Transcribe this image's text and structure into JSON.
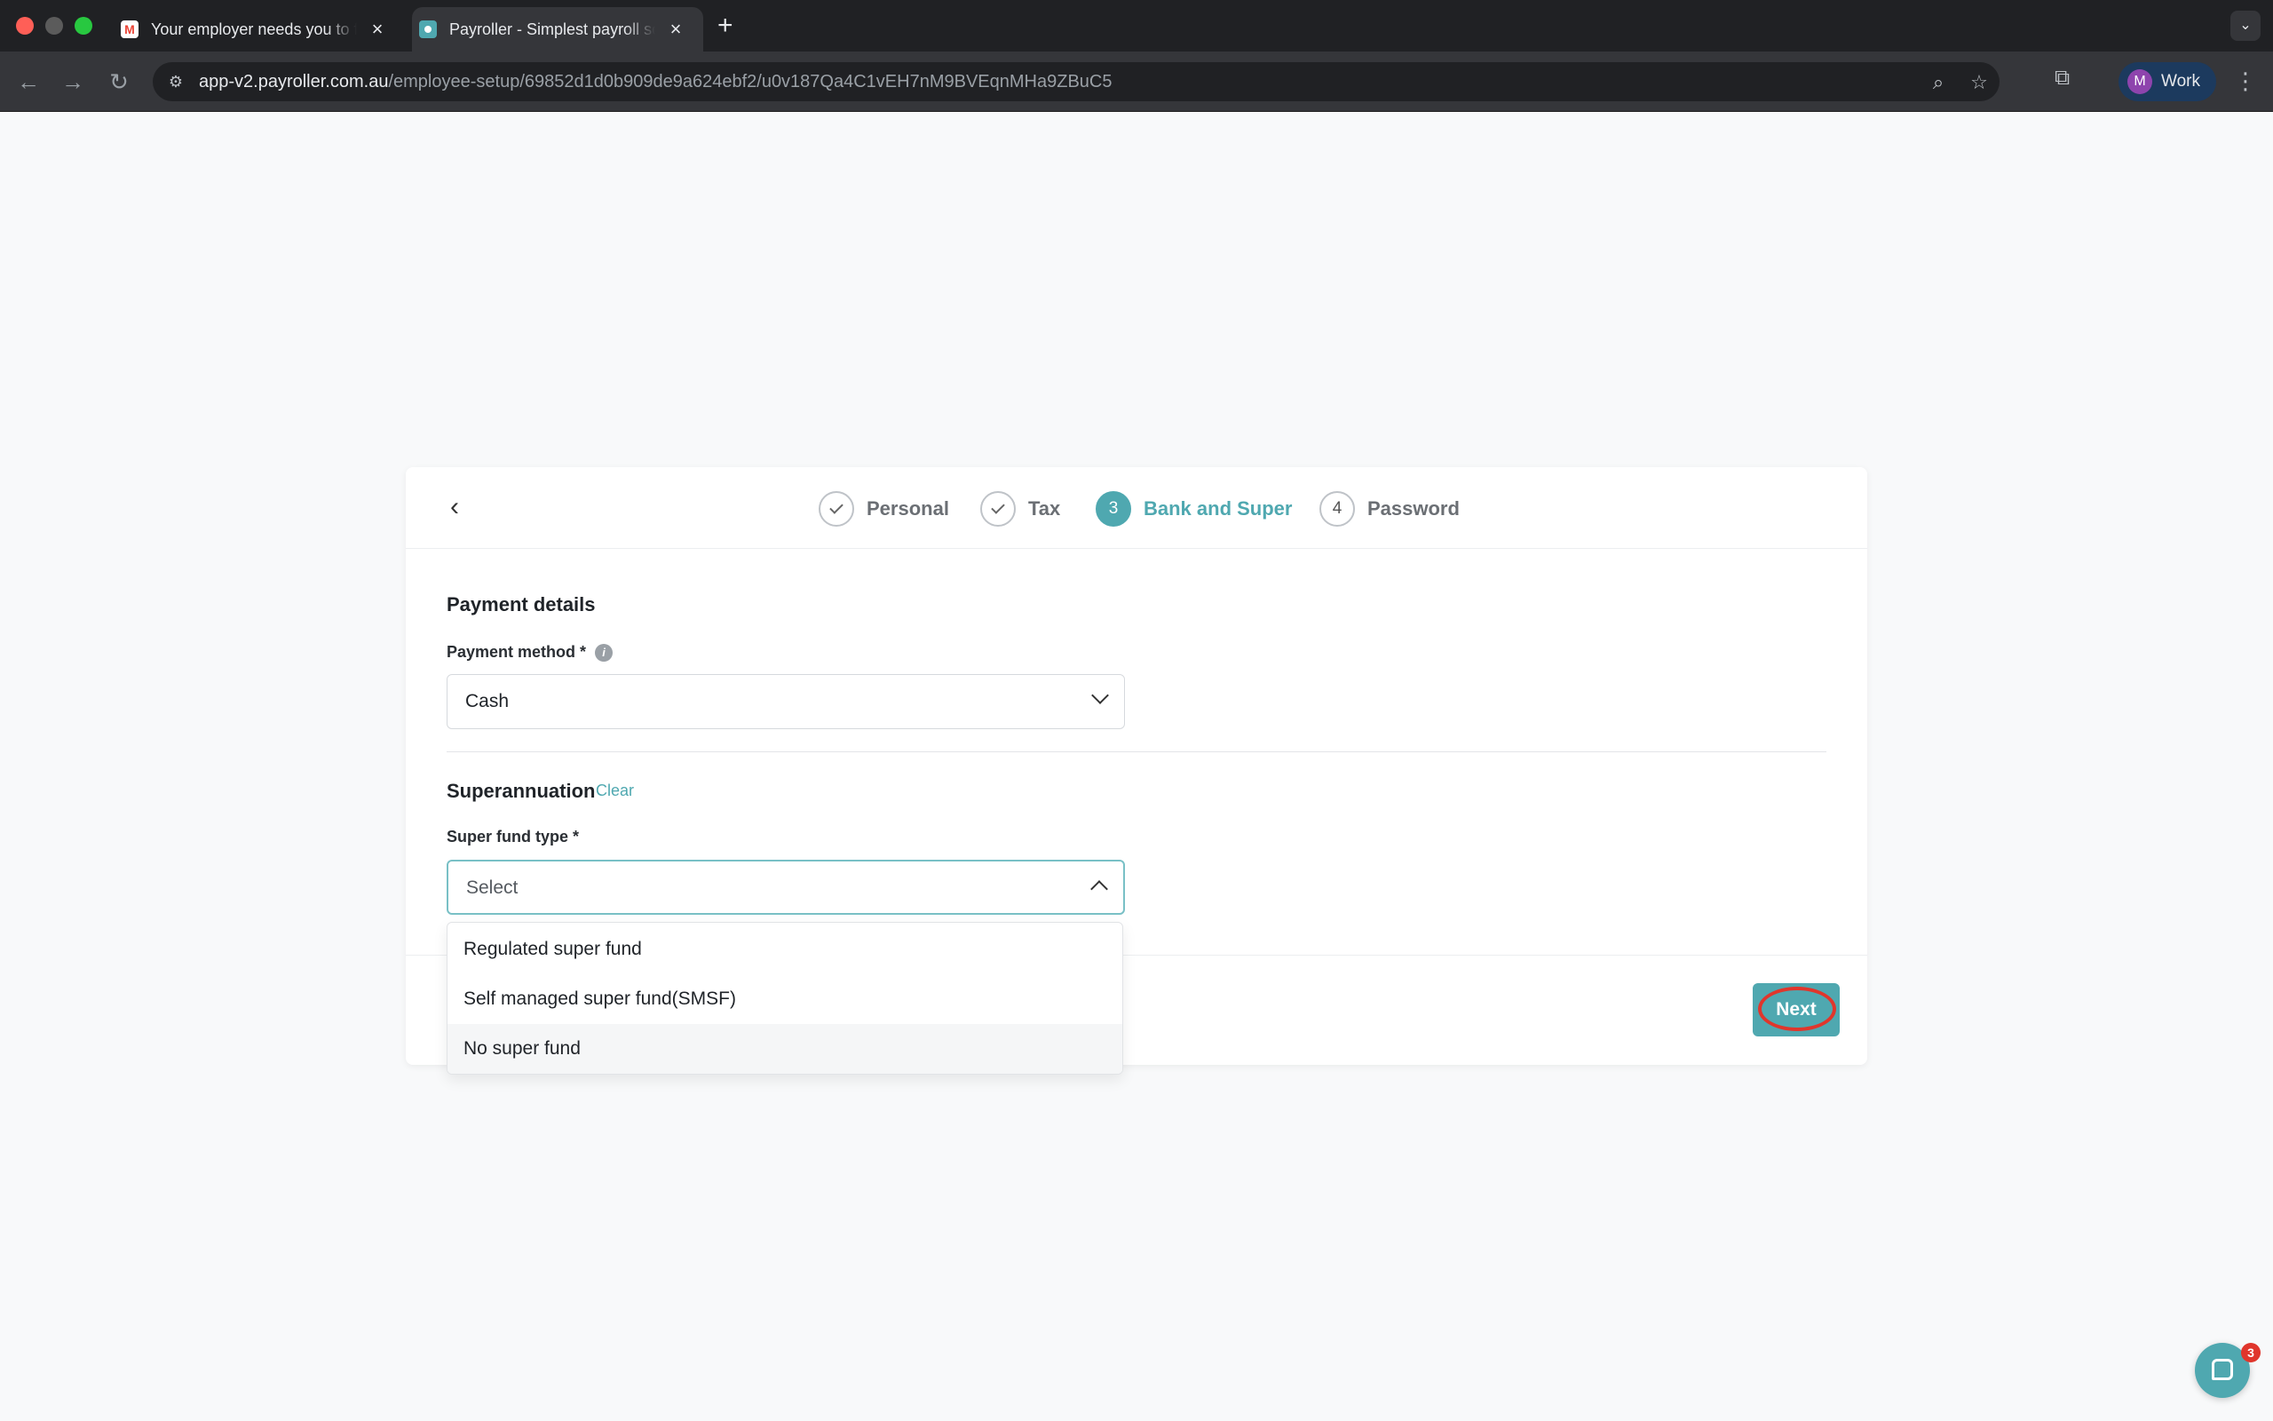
{
  "browser": {
    "tabs": [
      {
        "title": "Your employer needs you to f",
        "favicon": "gmail-icon",
        "active": false
      },
      {
        "title": "Payroller - Simplest payroll so",
        "favicon": "payroller-icon",
        "active": true
      }
    ],
    "url_host": "app-v2.payroller.com.au",
    "url_path": "/employee-setup/69852d1d0b909de9a624ebf2/u0v187Qa4C1vEH7nM9BVEqnMHa9ZBuC5",
    "profile_initial": "M",
    "profile_name": "Work"
  },
  "stepper": {
    "steps": [
      {
        "number": "1",
        "label": "Personal",
        "state": "complete"
      },
      {
        "number": "2",
        "label": "Tax",
        "state": "complete"
      },
      {
        "number": "3",
        "label": "Bank and Super",
        "state": "active"
      },
      {
        "number": "4",
        "label": "Password",
        "state": "pending"
      }
    ]
  },
  "payment": {
    "section_title": "Payment details",
    "method_label": "Payment method *",
    "method_value": "Cash"
  },
  "super": {
    "section_title": "Superannuation",
    "clear_label": "Clear",
    "fund_type_label": "Super fund type *",
    "fund_type_placeholder": "Select",
    "options": [
      "Regulated super fund",
      "Self managed super fund(SMSF)",
      "No super fund"
    ]
  },
  "footer": {
    "next_label": "Next"
  },
  "chat": {
    "badge_count": "3"
  },
  "colors": {
    "accent": "#4fa8b0",
    "highlight_ring": "#e0362c"
  }
}
